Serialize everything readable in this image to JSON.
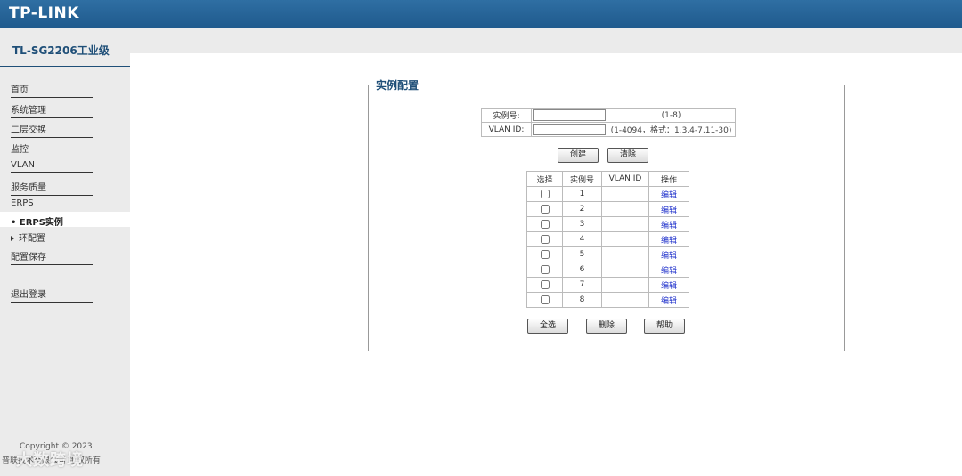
{
  "header": {
    "logo": "TP-LINK"
  },
  "model": {
    "title": "TL-SG2206工业级"
  },
  "sidebar": {
    "items": [
      {
        "label": "首页"
      },
      {
        "label": "系统管理"
      },
      {
        "label": "二层交换"
      },
      {
        "label": "监控"
      },
      {
        "label": "VLAN"
      },
      {
        "label": "服务质量"
      },
      {
        "label": "ERPS"
      }
    ],
    "active_sub": "• ERPS实例",
    "sub": "环配置",
    "save": "配置保存",
    "logout": "退出登录",
    "copyright": "Copyright © 2023",
    "company": "普联技术有限公司 版权所有",
    "watermark": "大数跨境"
  },
  "panel": {
    "legend": "实例配置",
    "instance_label": "实例号:",
    "instance_value": "",
    "instance_hint": "(1-8)",
    "vlan_label": "VLAN ID:",
    "vlan_value": "",
    "vlan_hint": "(1-4094，格式：1,3,4-7,11-30)",
    "create_button": "创建",
    "clear_button": "清除",
    "select_all_button": "全选",
    "delete_button": "删除",
    "help_button": "帮助"
  },
  "table": {
    "headers": [
      "选择",
      "实例号",
      "VLAN ID",
      "操作"
    ],
    "rows": [
      {
        "id": "1",
        "vlan": "",
        "action": "编辑"
      },
      {
        "id": "2",
        "vlan": "",
        "action": "编辑"
      },
      {
        "id": "3",
        "vlan": "",
        "action": "编辑"
      },
      {
        "id": "4",
        "vlan": "",
        "action": "编辑"
      },
      {
        "id": "5",
        "vlan": "",
        "action": "编辑"
      },
      {
        "id": "6",
        "vlan": "",
        "action": "编辑"
      },
      {
        "id": "7",
        "vlan": "",
        "action": "编辑"
      },
      {
        "id": "8",
        "vlan": "",
        "action": "编辑"
      }
    ]
  }
}
